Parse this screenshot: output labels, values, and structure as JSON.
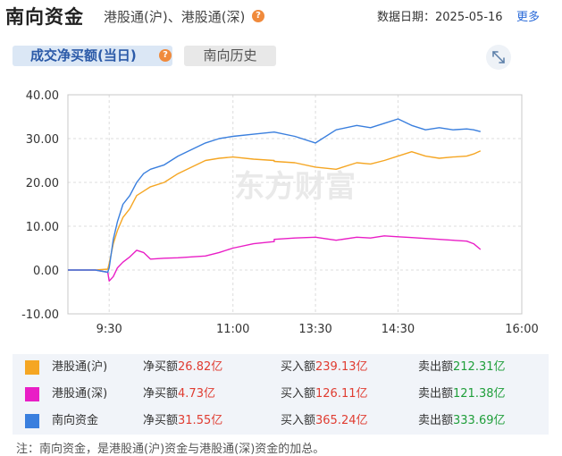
{
  "header": {
    "title": "南向资金",
    "subtitle": "港股通(沪)、港股通(深)",
    "date_label": "数据日期：2025-05-16",
    "more_label": "更多"
  },
  "tabs": [
    {
      "label": "成交净买额(当日)",
      "active": true
    },
    {
      "label": "南向历史",
      "active": false
    }
  ],
  "watermark": "东方财富",
  "colors": {
    "hk_sh": "#f5a623",
    "hk_sz": "#e91ec6",
    "southbound": "#3a7fde",
    "positive": "#e03c31",
    "negative": "#1f9e3a"
  },
  "chart_data": {
    "type": "line",
    "title": "",
    "xlabel": "",
    "ylabel": "",
    "ylim": [
      -10,
      40
    ],
    "yticks": [
      "40.00",
      "30.00",
      "20.00",
      "10.00",
      "0.00",
      "-10.00"
    ],
    "xticks": [
      "9:30",
      "11:00",
      "13:30",
      "14:30",
      "16:00"
    ],
    "grid": true,
    "series": [
      {
        "name": "港股通(沪)",
        "x": [
          "9:00",
          "9:20",
          "9:29",
          "9:30",
          "9:33",
          "9:36",
          "9:40",
          "9:45",
          "9:50",
          "9:55",
          "10:00",
          "10:10",
          "10:20",
          "10:30",
          "10:40",
          "10:50",
          "11:00",
          "11:15",
          "11:30",
          "13:00",
          "13:15",
          "13:30",
          "13:45",
          "14:00",
          "14:10",
          "14:20",
          "14:30",
          "14:40",
          "14:50",
          "15:00",
          "15:10",
          "15:20",
          "15:25",
          "15:30"
        ],
        "y": [
          0,
          0,
          0.2,
          1.5,
          6,
          9,
          12,
          14,
          17,
          18,
          19,
          20,
          22,
          23.5,
          25,
          25.5,
          25.8,
          25.3,
          25,
          24.8,
          24.5,
          23.5,
          23,
          24.5,
          24.2,
          25,
          26,
          27,
          26,
          25.5,
          25.8,
          26,
          26.5,
          27.2
        ]
      },
      {
        "name": "港股通(深)",
        "x": [
          "9:00",
          "9:20",
          "9:29",
          "9:30",
          "9:33",
          "9:36",
          "9:40",
          "9:45",
          "9:50",
          "9:55",
          "10:00",
          "10:10",
          "10:20",
          "10:30",
          "10:40",
          "10:50",
          "11:00",
          "11:15",
          "11:30",
          "13:00",
          "13:15",
          "13:30",
          "13:45",
          "14:00",
          "14:10",
          "14:20",
          "14:30",
          "14:40",
          "14:50",
          "15:00",
          "15:10",
          "15:20",
          "15:25",
          "15:30"
        ],
        "y": [
          0,
          0,
          -0.5,
          -2.5,
          -1.5,
          0.5,
          1.8,
          3,
          4.5,
          4,
          2.5,
          2.7,
          2.8,
          3,
          3.2,
          4,
          5,
          6,
          6.5,
          7,
          7.3,
          7.5,
          6.8,
          7.5,
          7.3,
          7.8,
          7.6,
          7.4,
          7.2,
          7,
          6.8,
          6.6,
          6,
          4.7
        ]
      },
      {
        "name": "南向资金",
        "x": [
          "9:00",
          "9:20",
          "9:29",
          "9:30",
          "9:33",
          "9:36",
          "9:40",
          "9:45",
          "9:50",
          "9:55",
          "10:00",
          "10:10",
          "10:20",
          "10:30",
          "10:40",
          "10:50",
          "11:00",
          "11:15",
          "11:30",
          "13:00",
          "13:15",
          "13:30",
          "13:45",
          "14:00",
          "14:10",
          "14:20",
          "14:30",
          "14:40",
          "14:50",
          "15:00",
          "15:10",
          "15:20",
          "15:25",
          "15:30"
        ],
        "y": [
          0,
          0,
          -0.5,
          0.5,
          7,
          11,
          15,
          17,
          20,
          22,
          23,
          24,
          26,
          27.5,
          29,
          30,
          30.5,
          31,
          31.5,
          31.5,
          30.5,
          29,
          32,
          33,
          32.5,
          33.5,
          34.5,
          33,
          32,
          32.5,
          32,
          32.2,
          32,
          31.6
        ]
      }
    ]
  },
  "legend": {
    "rows": [
      {
        "name": "港股通(沪)",
        "net_label": "净买额",
        "net_value": "26.82亿",
        "buy_label": "买入额",
        "buy_value": "239.13亿",
        "sell_label": "卖出额",
        "sell_value": "212.31亿"
      },
      {
        "name": "港股通(深)",
        "net_label": "净买额",
        "net_value": "4.73亿",
        "buy_label": "买入额",
        "buy_value": "126.11亿",
        "sell_label": "卖出额",
        "sell_value": "121.38亿"
      },
      {
        "name": "南向资金",
        "net_label": "净买额",
        "net_value": "31.55亿",
        "buy_label": "买入额",
        "buy_value": "365.24亿",
        "sell_label": "卖出额",
        "sell_value": "333.69亿"
      }
    ]
  },
  "note": "注：南向资金，是港股通(沪)资金与港股通(深)资金的加总。"
}
